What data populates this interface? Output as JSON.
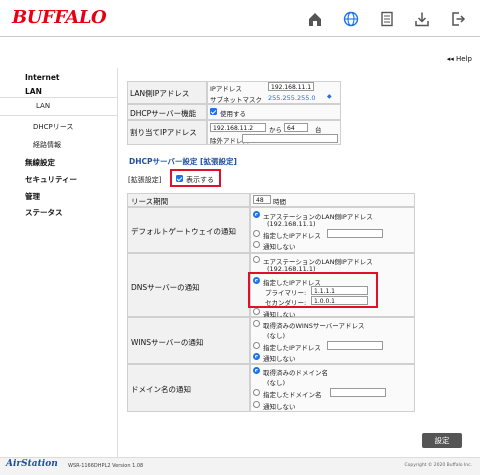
{
  "header": {
    "logo": "BUFFALO",
    "icons": [
      "home-icon",
      "globe-icon",
      "document-icon",
      "download-icon",
      "logout-icon"
    ]
  },
  "help": "◂◂ Help",
  "nav": {
    "internet": "Internet",
    "lan": "LAN",
    "lan_sub": "LAN",
    "dhcp_lease": "DHCPリース",
    "route": "経路情報",
    "wireless": "無線設定",
    "security": "セキュリティー",
    "admin": "管理",
    "status": "ステータス"
  },
  "lan_table": {
    "row1_label": "LAN側IPアドレス",
    "ip_label": "IPアドレス",
    "ip_value": "192.168.11.1",
    "subnet_label": "サブネットマスク",
    "subnet_value": "255.255.255.0",
    "row2_label": "DHCPサーバー機能",
    "dhcp_use": "使用する",
    "row3_label": "割り当てIPアドレス",
    "assign_start": "192.168.11.2",
    "assign_from": "から",
    "assign_count": "64",
    "assign_unit": "台",
    "exclude_label": "除外アドレス"
  },
  "dhcp_section": {
    "title": "DHCPサーバー設定 [拡張設定]",
    "ext_label": "[拡張設定]",
    "show_label": "表示する"
  },
  "lease": {
    "label": "リース期間",
    "value": "48",
    "unit": "時間"
  },
  "gateway": {
    "label": "デフォルトゲートウェイの通知",
    "opt1": "エアステーションのLAN側IPアドレス",
    "opt1_sub": "(192.168.11.1)",
    "opt2": "指定したIPアドレス",
    "opt3": "通知しない"
  },
  "dns": {
    "label": "DNSサーバーの通知",
    "opt1": "エアステーションのLAN側IPアドレス",
    "opt1_sub": "(192.168.11.1)",
    "opt2": "指定したIPアドレス",
    "primary_label": "プライマリー:",
    "primary_value": "1.1.1.1",
    "secondary_label": "セカンダリー:",
    "secondary_value": "1.0.0.1",
    "opt3": "通知しない"
  },
  "wins": {
    "label": "WINSサーバーの通知",
    "opt1": "取得済みのWINSサーバーアドレス",
    "opt1_sub": "(なし)",
    "opt2": "指定したIPアドレス",
    "opt3": "通知しない"
  },
  "domain": {
    "label": "ドメイン名の通知",
    "opt1": "取得済みのドメイン名",
    "opt1_sub": "(なし)",
    "opt2": "指定したドメイン名",
    "opt3": "通知しない"
  },
  "save_button": "設定",
  "footer": {
    "brand": "AirStation",
    "version": "WSR-1166DHPL2 Version 1.08",
    "copyright": "Copyright © 2020 Buffalo Inc."
  }
}
